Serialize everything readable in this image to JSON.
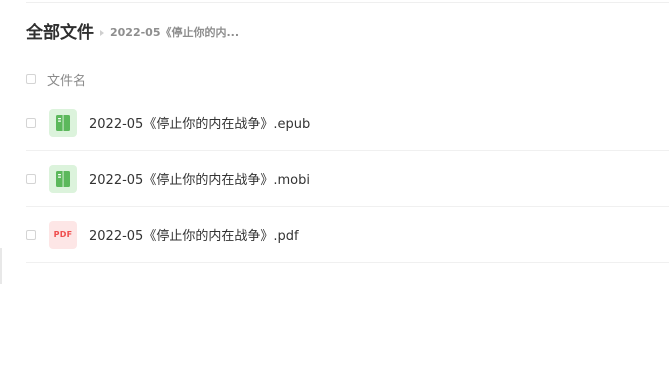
{
  "breadcrumb": {
    "root": "全部文件",
    "current": "2022-05《停止你的内..."
  },
  "list": {
    "header_label": "文件名",
    "files": [
      {
        "name": "2022-05《停止你的内在战争》.epub",
        "icon": "ebook-icon"
      },
      {
        "name": "2022-05《停止你的内在战争》.mobi",
        "icon": "ebook-icon"
      },
      {
        "name": "2022-05《停止你的内在战争》.pdf",
        "icon": "pdf-icon",
        "icon_text": "PDF"
      }
    ]
  },
  "colors": {
    "ebook_icon_bg": "#dcf3dc",
    "ebook_icon_fg": "#5cb85c",
    "pdf_icon_bg": "#fde6e6",
    "pdf_icon_fg": "#ef4e4e"
  }
}
